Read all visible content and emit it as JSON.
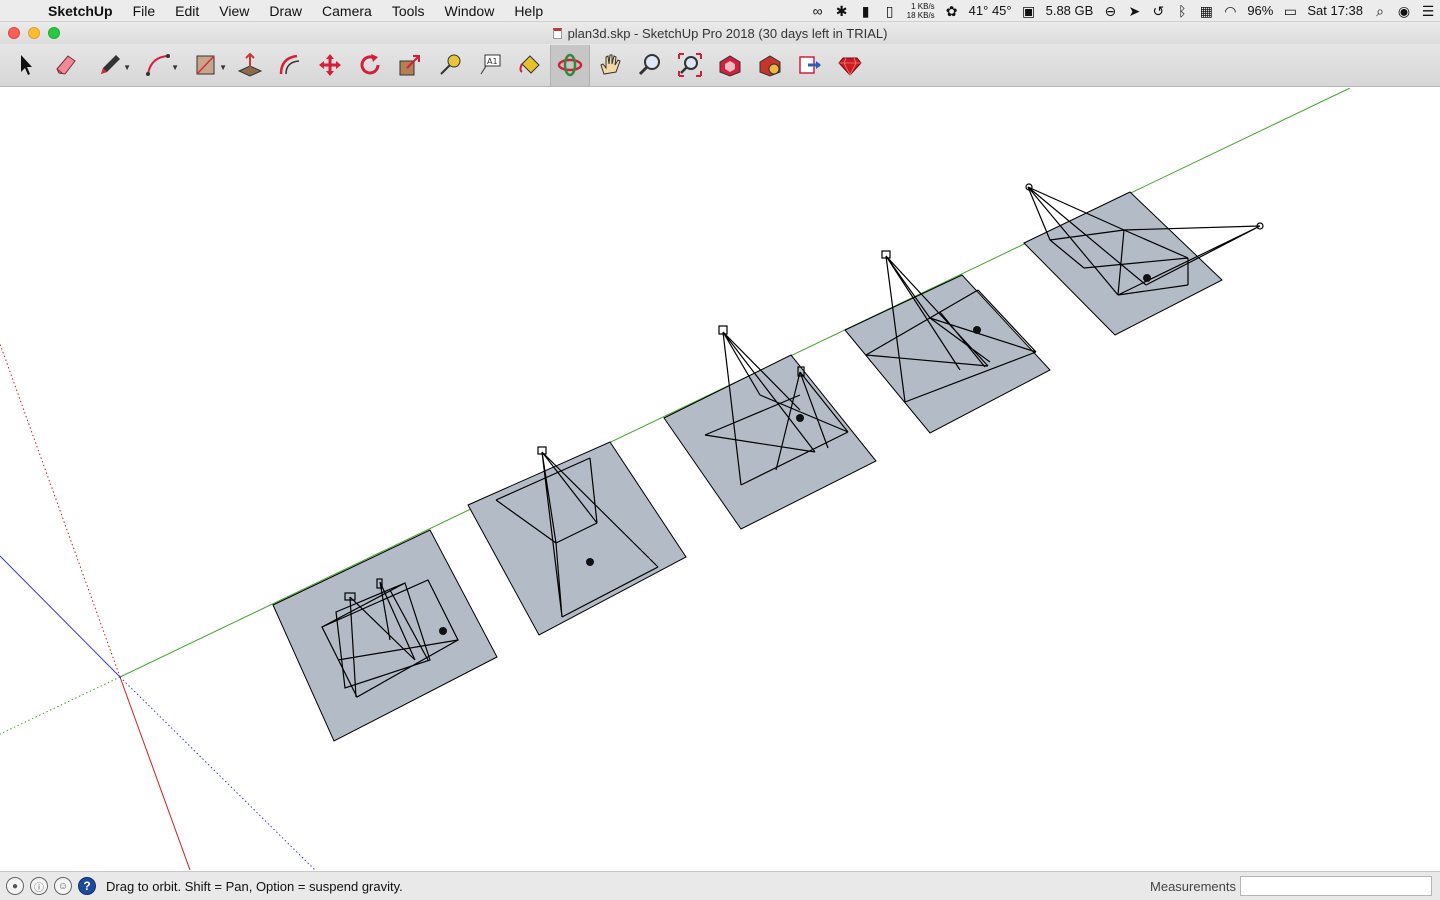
{
  "menubar": {
    "app_name": "SketchUp",
    "items": [
      "File",
      "Edit",
      "View",
      "Draw",
      "Camera",
      "Tools",
      "Window",
      "Help"
    ],
    "status": {
      "net_up": "1 KB/s",
      "net_down": "18 KB/s",
      "temps": "41° 45°",
      "memory": "5.88 GB",
      "battery": "96%",
      "clock": "Sat 17:38"
    }
  },
  "window": {
    "title": "plan3d.skp - SketchUp Pro 2018 (30 days left in TRIAL)"
  },
  "toolbar": {
    "tools": [
      {
        "name": "select-tool",
        "icon": "arrow-cursor-icon"
      },
      {
        "name": "eraser-tool",
        "icon": "eraser-icon"
      },
      {
        "name": "pencil-tool",
        "icon": "pencil-icon",
        "dropdown": true
      },
      {
        "name": "arc-tool",
        "icon": "arc-icon",
        "dropdown": true
      },
      {
        "name": "rectangle-tool",
        "icon": "rectangle-icon",
        "dropdown": true
      },
      {
        "name": "push-pull-tool",
        "icon": "push-pull-icon"
      },
      {
        "name": "offset-tool",
        "icon": "offset-icon"
      },
      {
        "name": "move-tool",
        "icon": "move-arrows-icon"
      },
      {
        "name": "rotate-tool",
        "icon": "rotate-icon"
      },
      {
        "name": "scale-tool",
        "icon": "scale-icon"
      },
      {
        "name": "tape-measure-tool",
        "icon": "tape-measure-icon"
      },
      {
        "name": "text-tool",
        "icon": "text-label-icon"
      },
      {
        "name": "paint-bucket-tool",
        "icon": "paint-bucket-icon"
      },
      {
        "name": "orbit-tool",
        "icon": "orbit-icon",
        "active": true
      },
      {
        "name": "pan-tool",
        "icon": "hand-icon"
      },
      {
        "name": "zoom-tool",
        "icon": "magnifier-icon"
      },
      {
        "name": "zoom-extents-tool",
        "icon": "zoom-extents-icon"
      },
      {
        "name": "warehouse-tool",
        "icon": "3d-warehouse-icon"
      },
      {
        "name": "extension-warehouse-tool",
        "icon": "extension-warehouse-icon"
      },
      {
        "name": "send-to-layout-tool",
        "icon": "send-to-layout-icon"
      },
      {
        "name": "ruby-console-tool",
        "icon": "ruby-gem-icon"
      }
    ]
  },
  "statusbar": {
    "hint": "Drag to orbit. Shift = Pan, Option = suspend gravity.",
    "measurements_label": "Measurements",
    "measurements_value": ""
  },
  "colors": {
    "plane_fill": "#b3bcc6",
    "axis_green": "#3fa52a",
    "axis_red": "#d21d1d",
    "axis_blue": "#3a3ad6",
    "edge": "#000000"
  }
}
